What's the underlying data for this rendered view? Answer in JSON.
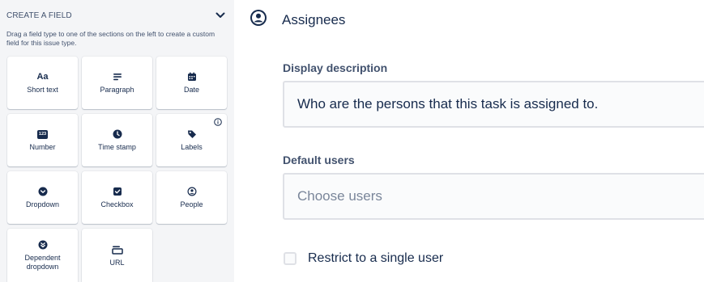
{
  "palette": {
    "title": "CREATE A FIELD",
    "help_text": "Drag a field type to one of the sections on the left to create a custom field for this issue type.",
    "tiles": [
      {
        "label": "Short text",
        "icon": "short-text-icon",
        "glyph": "Aa"
      },
      {
        "label": "Paragraph",
        "icon": "paragraph-icon"
      },
      {
        "label": "Date",
        "icon": "calendar-icon"
      },
      {
        "label": "Number",
        "icon": "number-icon",
        "glyph": "123"
      },
      {
        "label": "Time stamp",
        "icon": "clock-icon"
      },
      {
        "label": "Labels",
        "icon": "tag-icon"
      },
      {
        "label": "Dropdown",
        "icon": "chevron-circle-icon"
      },
      {
        "label": "Checkbox",
        "icon": "checkbox-icon"
      },
      {
        "label": "People",
        "icon": "person-circle-icon"
      },
      {
        "label": "Dependent dropdown",
        "icon": "dependent-dropdown-icon"
      },
      {
        "label": "URL",
        "icon": "url-icon"
      }
    ]
  },
  "field": {
    "name": "Assignees",
    "icon": "person-circle-icon",
    "display_description_label": "Display description",
    "display_description_value": "Who are the persons that this task is assigned to.",
    "default_users_label": "Default users",
    "default_users_placeholder": "Choose users",
    "restrict_label": "Restrict to a single user",
    "restrict_checked": false
  },
  "colors": {
    "panel_bg": "#f4f5f7",
    "text_primary": "#172b4d",
    "text_secondary": "#42526e",
    "placeholder": "#7a869a",
    "input_border": "#dfe1e6"
  }
}
